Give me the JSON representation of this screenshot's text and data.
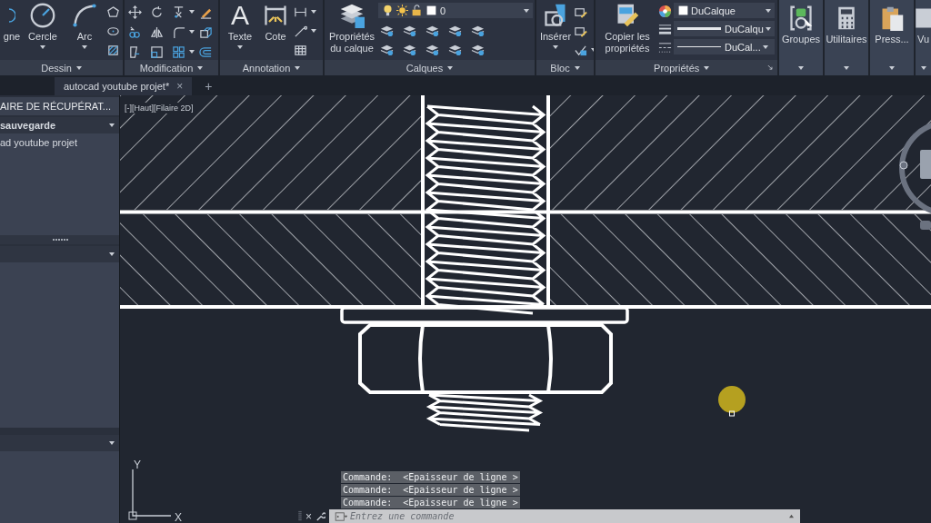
{
  "ribbon": {
    "dessin": {
      "tools": [
        "gne",
        "Cercle",
        "Arc"
      ],
      "title": "Dessin"
    },
    "modification": {
      "title": "Modification"
    },
    "annotation": {
      "glyph": "A",
      "tools": [
        "Texte",
        "Cote"
      ],
      "title": "Annotation"
    },
    "calques": {
      "tool": "Propriétés du calque",
      "layer": "0",
      "title": "Calques"
    },
    "bloc": {
      "tool": "Insérer",
      "title": "Bloc"
    },
    "proprietes": {
      "tool": "Copier les propriétés",
      "color_value": "DuCalque",
      "lineweight": "DuCalqu",
      "linetype": "DuCal...",
      "title": "Propriétés"
    },
    "buttons": [
      "Groupes",
      "Utilitaires",
      "Press...",
      "Vu"
    ]
  },
  "tabs": [
    {
      "label": "autocad youtube projet*",
      "selected": true
    }
  ],
  "close_tab": "×",
  "new_tab": "+",
  "recovery_panel": {
    "title": "AIRE DE RÉCUPÉRAT...",
    "section": "sauvegarde",
    "files": [
      "ad youtube projet"
    ]
  },
  "viewport": {
    "label": "[-][Haut][Filaire 2D]"
  },
  "command_history": [
    "Commande:  <Epaisseur de ligne >",
    "Commande:  <Epaisseur de ligne >",
    "Commande:  <Epaisseur de ligne >"
  ],
  "command_line": {
    "close": "×",
    "placeholder": "Entrez une commande"
  },
  "ucs": {
    "y": "Y",
    "x": "X"
  }
}
